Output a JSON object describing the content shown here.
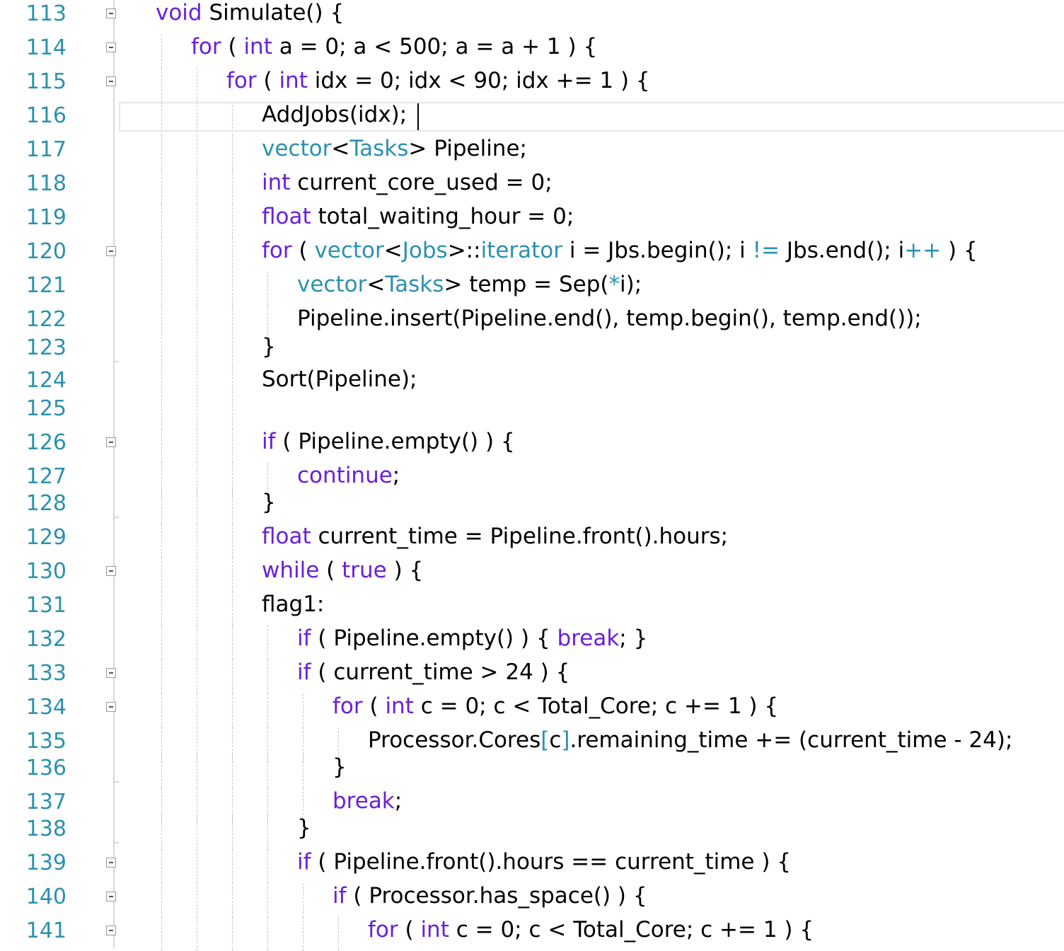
{
  "editor": {
    "colors": {
      "line_number": "#2b91af",
      "keyword": "#6a20d8",
      "type": "#2b91af",
      "text": "#000000",
      "background": "#ffffff"
    },
    "cursor_line": 116,
    "lines": [
      {
        "n": "113",
        "indent": 0,
        "fold": true,
        "tokens": [
          [
            "k",
            "void"
          ],
          [
            "p",
            " Simulate() {"
          ]
        ]
      },
      {
        "n": "114",
        "indent": 1,
        "fold": true,
        "tokens": [
          [
            "k",
            "for"
          ],
          [
            "p",
            " ( "
          ],
          [
            "k",
            "int"
          ],
          [
            "p",
            " a = 0; a < 500; a = a + 1 ) {"
          ]
        ]
      },
      {
        "n": "115",
        "indent": 2,
        "fold": true,
        "tokens": [
          [
            "k",
            "for"
          ],
          [
            "p",
            " ( "
          ],
          [
            "k",
            "int"
          ],
          [
            "p",
            " idx = 0; idx < 90; idx += 1 ) {"
          ]
        ]
      },
      {
        "n": "116",
        "indent": 3,
        "fold": false,
        "tokens": [
          [
            "p",
            "AddJobs(idx);"
          ]
        ]
      },
      {
        "n": "117",
        "indent": 3,
        "fold": false,
        "tokens": [
          [
            "y",
            "vector"
          ],
          [
            "p",
            "<"
          ],
          [
            "y",
            "Tasks"
          ],
          [
            "p",
            "> Pipeline;"
          ]
        ]
      },
      {
        "n": "118",
        "indent": 3,
        "fold": false,
        "tokens": [
          [
            "k",
            "int"
          ],
          [
            "p",
            " current_core_used = 0;"
          ]
        ]
      },
      {
        "n": "119",
        "indent": 3,
        "fold": false,
        "tokens": [
          [
            "k",
            "float"
          ],
          [
            "p",
            " total_waiting_hour = 0;"
          ]
        ]
      },
      {
        "n": "120",
        "indent": 3,
        "fold": true,
        "tokens": [
          [
            "k",
            "for"
          ],
          [
            "p",
            " ( "
          ],
          [
            "y",
            "vector"
          ],
          [
            "p",
            "<"
          ],
          [
            "y",
            "Jobs"
          ],
          [
            "p",
            ">::"
          ],
          [
            "y",
            "iterator"
          ],
          [
            "p",
            " i = Jbs.begin(); i "
          ],
          [
            "y",
            "!="
          ],
          [
            "p",
            " Jbs.end(); i"
          ],
          [
            "y",
            "++"
          ],
          [
            "p",
            " ) {"
          ]
        ]
      },
      {
        "n": "121",
        "indent": 4,
        "fold": false,
        "tokens": [
          [
            "y",
            "vector"
          ],
          [
            "p",
            "<"
          ],
          [
            "y",
            "Tasks"
          ],
          [
            "p",
            "> temp = Sep("
          ],
          [
            "y",
            "*"
          ],
          [
            "p",
            "i);"
          ]
        ]
      },
      {
        "n": "122",
        "indent": 4,
        "fold": false,
        "tokens": [
          [
            "p",
            "Pipeline.insert(Pipeline.end(), temp.begin(), temp.end());"
          ]
        ]
      },
      {
        "n": "123",
        "indent": 3,
        "fold": false,
        "tokens": [
          [
            "p",
            "}"
          ]
        ]
      },
      {
        "n": "124",
        "indent": 3,
        "fold": false,
        "tokens": [
          [
            "p",
            "Sort(Pipeline);"
          ]
        ]
      },
      {
        "n": "125",
        "indent": 3,
        "fold": false,
        "tokens": []
      },
      {
        "n": "126",
        "indent": 3,
        "fold": true,
        "tokens": [
          [
            "k",
            "if"
          ],
          [
            "p",
            " ( Pipeline.empty() ) {"
          ]
        ]
      },
      {
        "n": "127",
        "indent": 4,
        "fold": false,
        "tokens": [
          [
            "k",
            "continue"
          ],
          [
            "p",
            ";"
          ]
        ]
      },
      {
        "n": "128",
        "indent": 3,
        "fold": false,
        "tokens": [
          [
            "p",
            "}"
          ]
        ]
      },
      {
        "n": "129",
        "indent": 3,
        "fold": false,
        "tokens": [
          [
            "k",
            "float"
          ],
          [
            "p",
            " current_time = Pipeline.front().hours;"
          ]
        ]
      },
      {
        "n": "130",
        "indent": 3,
        "fold": true,
        "tokens": [
          [
            "k",
            "while"
          ],
          [
            "p",
            " ( "
          ],
          [
            "k",
            "true"
          ],
          [
            "p",
            " ) {"
          ]
        ]
      },
      {
        "n": "131",
        "indent": 3,
        "fold": false,
        "tokens": [
          [
            "p",
            "flag1:"
          ]
        ]
      },
      {
        "n": "132",
        "indent": 4,
        "fold": false,
        "tokens": [
          [
            "k",
            "if"
          ],
          [
            "p",
            " ( Pipeline.empty() ) { "
          ],
          [
            "k",
            "break"
          ],
          [
            "p",
            "; }"
          ]
        ]
      },
      {
        "n": "133",
        "indent": 4,
        "fold": true,
        "tokens": [
          [
            "k",
            "if"
          ],
          [
            "p",
            " ( current_time > 24 ) {"
          ]
        ]
      },
      {
        "n": "134",
        "indent": 5,
        "fold": true,
        "tokens": [
          [
            "k",
            "for"
          ],
          [
            "p",
            " ( "
          ],
          [
            "k",
            "int"
          ],
          [
            "p",
            " c = 0; c < Total_Core; c += 1 ) {"
          ]
        ]
      },
      {
        "n": "135",
        "indent": 6,
        "fold": false,
        "tokens": [
          [
            "p",
            "Processor.Cores"
          ],
          [
            "y",
            "["
          ],
          [
            "p",
            "c"
          ],
          [
            "y",
            "]"
          ],
          [
            "p",
            ".remaining_time += (current_time - 24);"
          ]
        ]
      },
      {
        "n": "136",
        "indent": 5,
        "fold": false,
        "tokens": [
          [
            "p",
            "}"
          ]
        ]
      },
      {
        "n": "137",
        "indent": 5,
        "fold": false,
        "tokens": [
          [
            "k",
            "break"
          ],
          [
            "p",
            ";"
          ]
        ]
      },
      {
        "n": "138",
        "indent": 4,
        "fold": false,
        "tokens": [
          [
            "p",
            "}"
          ]
        ]
      },
      {
        "n": "139",
        "indent": 4,
        "fold": true,
        "tokens": [
          [
            "k",
            "if"
          ],
          [
            "p",
            " ( Pipeline.front().hours == current_time ) {"
          ]
        ]
      },
      {
        "n": "140",
        "indent": 5,
        "fold": true,
        "tokens": [
          [
            "k",
            "if"
          ],
          [
            "p",
            " ( Processor.has_space() ) {"
          ]
        ]
      },
      {
        "n": "141",
        "indent": 6,
        "fold": true,
        "tokens": [
          [
            "k",
            "for"
          ],
          [
            "p",
            " ( "
          ],
          [
            "k",
            "int"
          ],
          [
            "p",
            " c = 0; c < Total_Core; c += 1 ) {"
          ]
        ]
      }
    ]
  }
}
